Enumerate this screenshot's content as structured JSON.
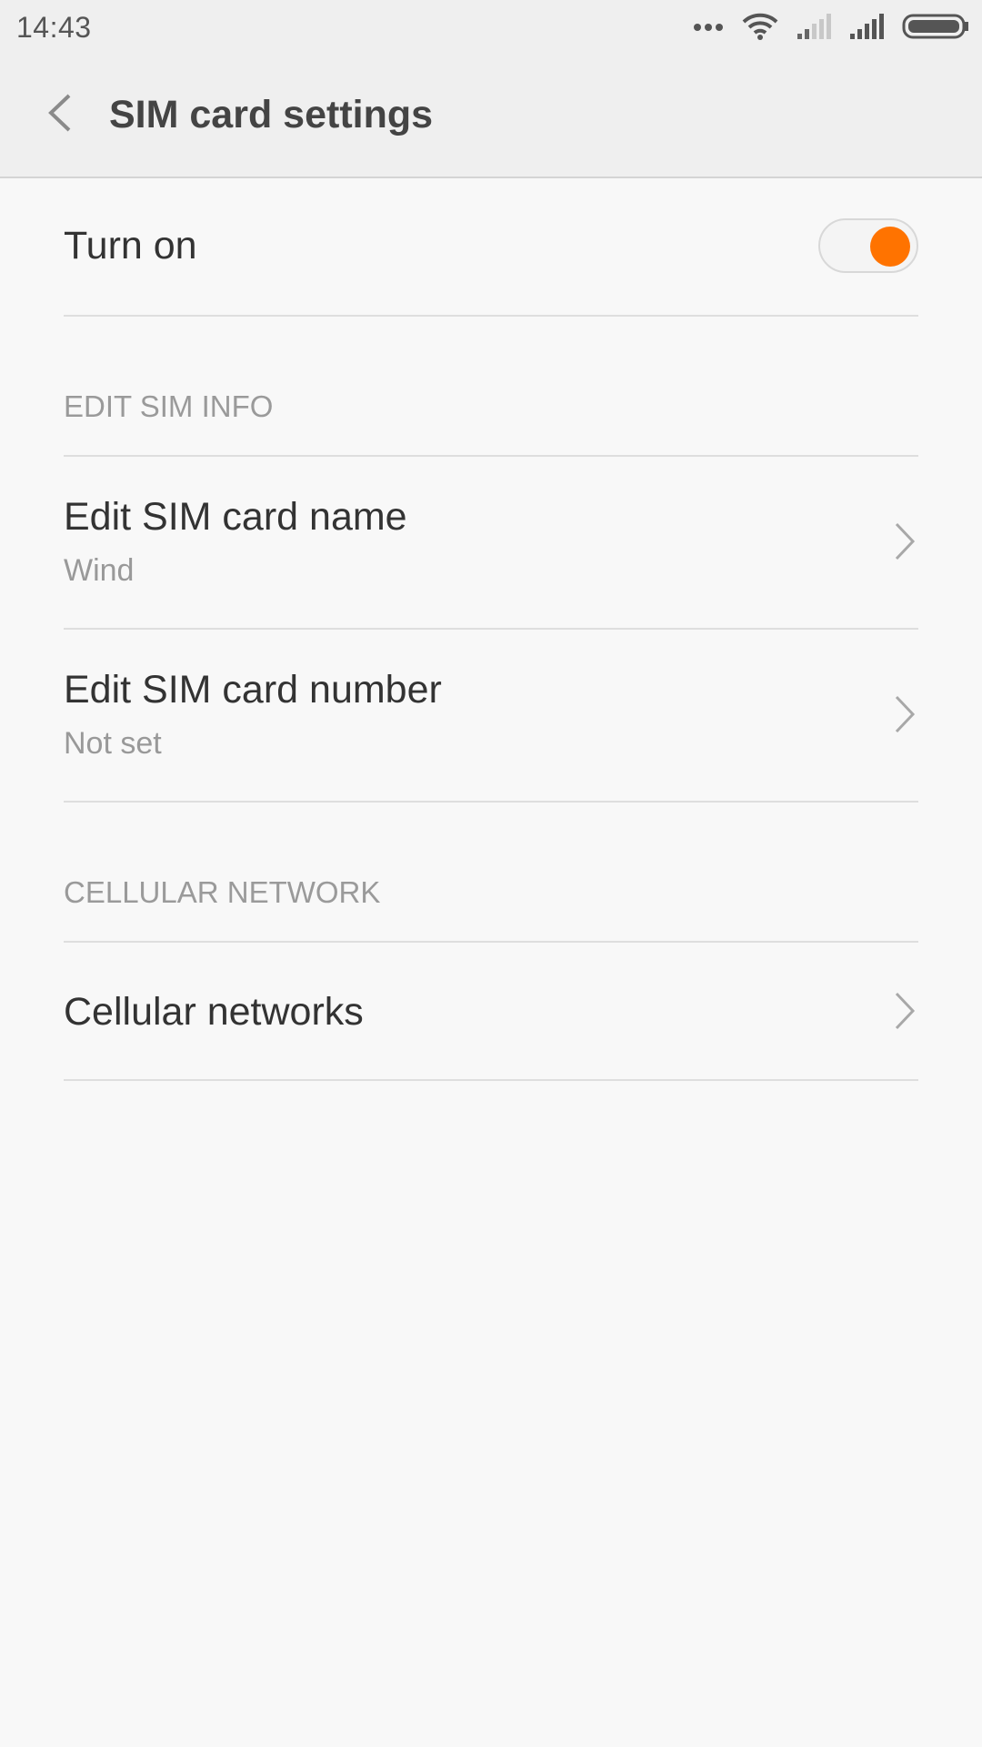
{
  "status_bar": {
    "time": "14:43",
    "icons": [
      "more-dots-icon",
      "wifi-icon",
      "signal-weak-icon",
      "signal-strong-icon",
      "battery-icon"
    ]
  },
  "header": {
    "back_icon": "chevron-left-icon",
    "title": "SIM card settings"
  },
  "turn_on": {
    "label": "Turn on",
    "enabled": true,
    "accent_color": "#ff7300"
  },
  "edit_sim_info": {
    "section_label": "EDIT SIM INFO",
    "items": [
      {
        "title": "Edit SIM card name",
        "subtitle": "Wind"
      },
      {
        "title": "Edit SIM card number",
        "subtitle": "Not set"
      }
    ]
  },
  "cellular_network": {
    "section_label": "CELLULAR NETWORK",
    "items": [
      {
        "title": "Cellular networks"
      }
    ]
  }
}
